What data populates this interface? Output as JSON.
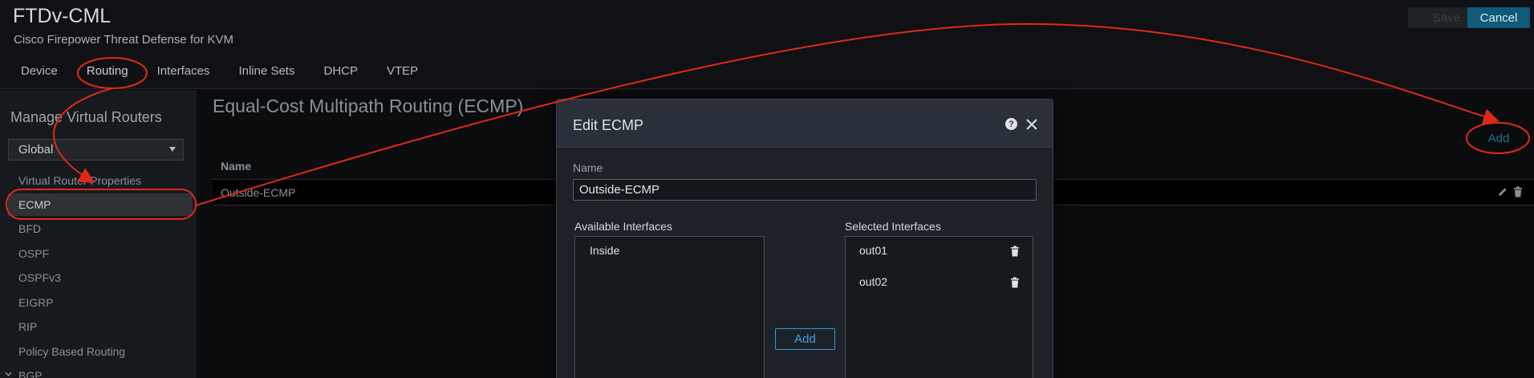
{
  "header": {
    "title": "FTDv-CML",
    "subtitle": "Cisco Firepower Threat Defense for KVM",
    "save_label": "Save",
    "cancel_label": "Cancel",
    "tabs": [
      {
        "label": "Device"
      },
      {
        "label": "Routing"
      },
      {
        "label": "Interfaces"
      },
      {
        "label": "Inline Sets"
      },
      {
        "label": "DHCP"
      },
      {
        "label": "VTEP"
      }
    ],
    "active_tab": "Routing"
  },
  "sidebar": {
    "title": "Manage Virtual Routers",
    "router_select": "Global",
    "items": [
      {
        "label": "Virtual Router Properties"
      },
      {
        "label": "ECMP"
      },
      {
        "label": "BFD"
      },
      {
        "label": "OSPF"
      },
      {
        "label": "OSPFv3"
      },
      {
        "label": "EIGRP"
      },
      {
        "label": "RIP"
      },
      {
        "label": "Policy Based Routing"
      },
      {
        "label": "BGP"
      }
    ],
    "active_item": "ECMP"
  },
  "main": {
    "title": "Equal-Cost Multipath Routing (ECMP)",
    "add_label": "Add",
    "table": {
      "columns": [
        "Name"
      ],
      "rows": [
        [
          "Outside-ECMP"
        ]
      ]
    }
  },
  "modal": {
    "title": "Edit ECMP",
    "name_label": "Name",
    "name_value": "Outside-ECMP",
    "available_label": "Available Interfaces",
    "available": [
      "Inside"
    ],
    "selected_label": "Selected Interfaces",
    "selected": [
      "out01",
      "out02"
    ],
    "add_label": "Add"
  },
  "colors": {
    "accent": "#36a7e0",
    "annotation": "#e0291a",
    "background": "#0b0c0e"
  }
}
